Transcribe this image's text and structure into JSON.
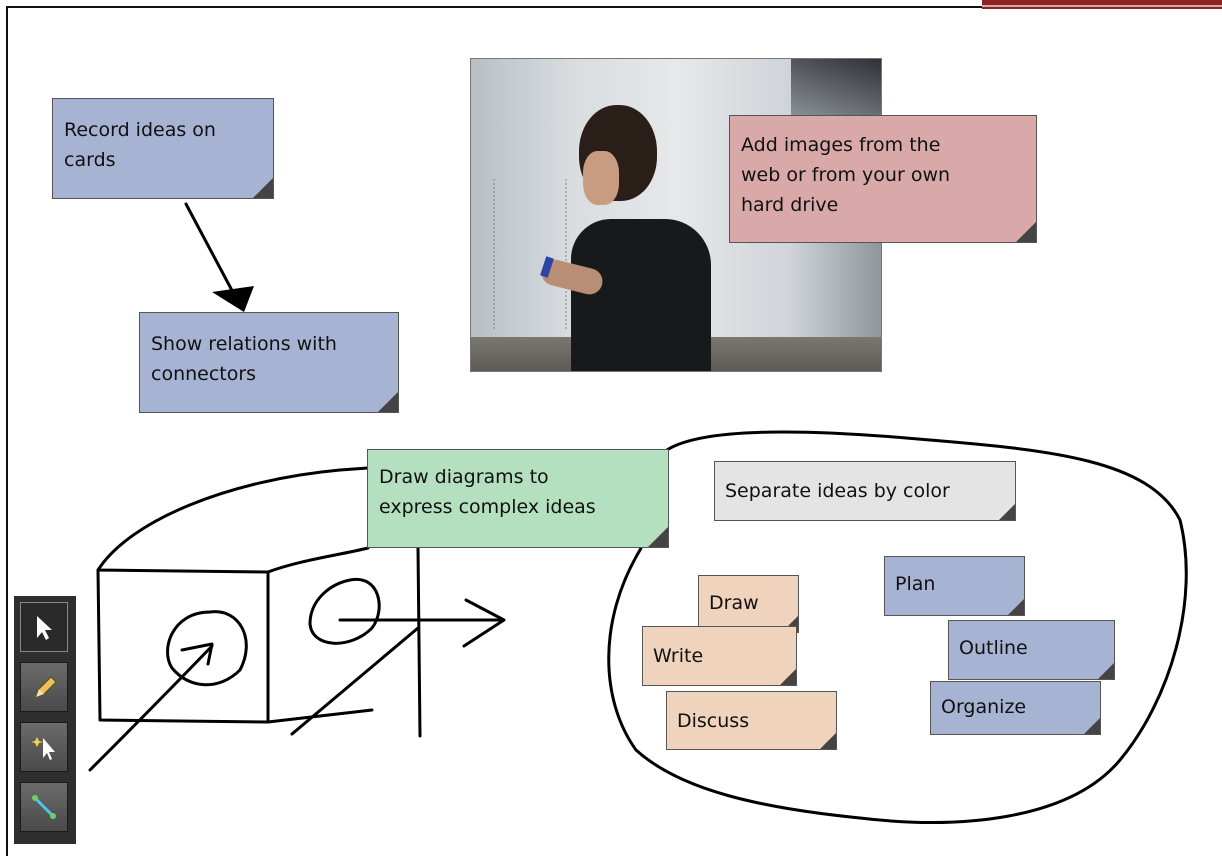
{
  "cards": {
    "record": "Record ideas on\ncards",
    "relations": "Show relations with\nconnectors",
    "images": "Add images from the\nweb or from your own\nhard drive",
    "diagrams": "Draw diagrams to\nexpress complex ideas",
    "color": "Separate ideas by color",
    "draw": "Draw",
    "write": "Write",
    "discuss": "Discuss",
    "plan": "Plan",
    "outline": "Outline",
    "organize": "Organize"
  },
  "colors": {
    "blue_card": "#a7b3d3",
    "pink_card": "#d9a9a9",
    "green_card": "#b4e0c0",
    "grey_card": "#e4e4e4",
    "tan_card": "#efd3bd",
    "brand": "#8d2323",
    "toolbar": "#2e2e2e"
  },
  "toolbar": {
    "tools": [
      {
        "icon": "select-arrow-icon",
        "active": true
      },
      {
        "icon": "pencil-icon",
        "active": false
      },
      {
        "icon": "magic-wand-icon",
        "active": false
      },
      {
        "icon": "connector-icon",
        "active": false
      }
    ]
  },
  "photo": {
    "icon": "whiteboard-photo"
  }
}
